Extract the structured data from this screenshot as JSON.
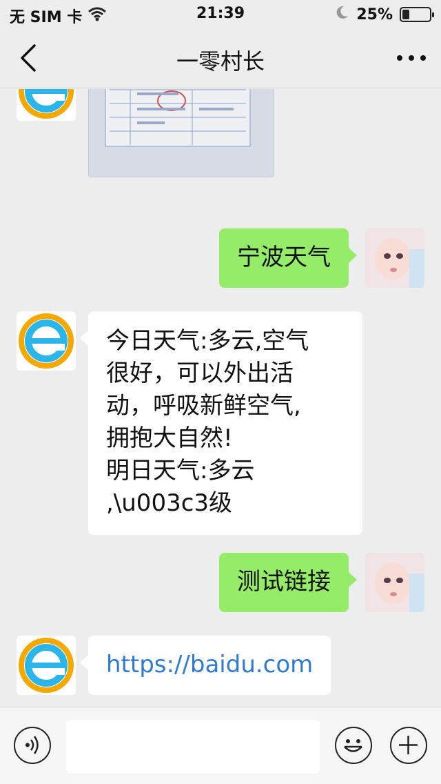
{
  "status_bar": {
    "carrier": "无 SIM 卡",
    "time": "21:39",
    "battery": "25%",
    "battery_level": 0.25
  },
  "nav": {
    "title": "一零村长"
  },
  "messages": [
    {
      "from": "bot",
      "type": "image"
    },
    {
      "from": "me",
      "type": "text",
      "text": "宁波天气"
    },
    {
      "from": "bot",
      "type": "text",
      "lines": [
        "今日天气:多云,空气",
        "很好，可以外出活",
        "动，呼吸新鲜空气,",
        "拥抱大自然!",
        "明日天气:多云",
        ",\\u003c3级"
      ]
    },
    {
      "from": "me",
      "type": "text",
      "text": "测试链接"
    },
    {
      "from": "bot",
      "type": "link",
      "text": "https://baidu.com"
    }
  ],
  "input_bar": {
    "value": ""
  },
  "colors": {
    "background": "#ededed",
    "outgoing_bubble": "#95ec69",
    "incoming_bubble": "#ffffff",
    "link": "#2f7bd2"
  }
}
